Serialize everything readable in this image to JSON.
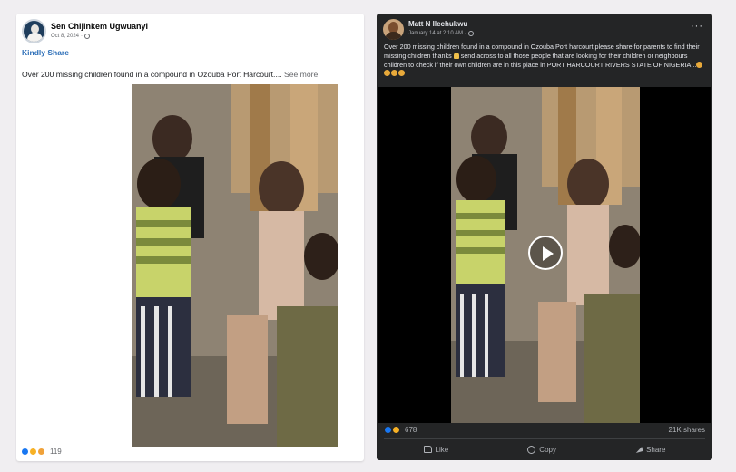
{
  "left_post": {
    "author": "Sen Chijinkem Ugwuanyi",
    "date": "Oct 8, 2024",
    "separator": "·",
    "headline": "Kindly Share",
    "text": "Over 200 missing children found in a compound in Ozouba Port Harcourt....",
    "see_more": "See more",
    "reaction_count": "119",
    "reactions": [
      "like-reaction-icon",
      "haha-reaction-icon",
      "sad-reaction-icon"
    ]
  },
  "right_post": {
    "author": "Matt N Ilechukwu",
    "date": "January 14 at 2:10 AM",
    "separator": "·",
    "menu_label": "···",
    "text_part1": "Over 200 missing children found in a compound in Ozouba Port harcourt please share for parents to find their missing children thanks",
    "text_part2": "send across to all those people that are looking for their children or neighbours children to check if their own children are in this place in PORT HARCOURT RIVERS STATE OF NIGERIA...",
    "reaction_count": "678",
    "shares": "21K shares",
    "actions": {
      "like": "Like",
      "copy": "Copy",
      "share": "Share"
    }
  },
  "colors": {
    "page_bg": "#f0eef1",
    "fb_blue": "#2d6fb8",
    "dark_card": "#242526"
  }
}
